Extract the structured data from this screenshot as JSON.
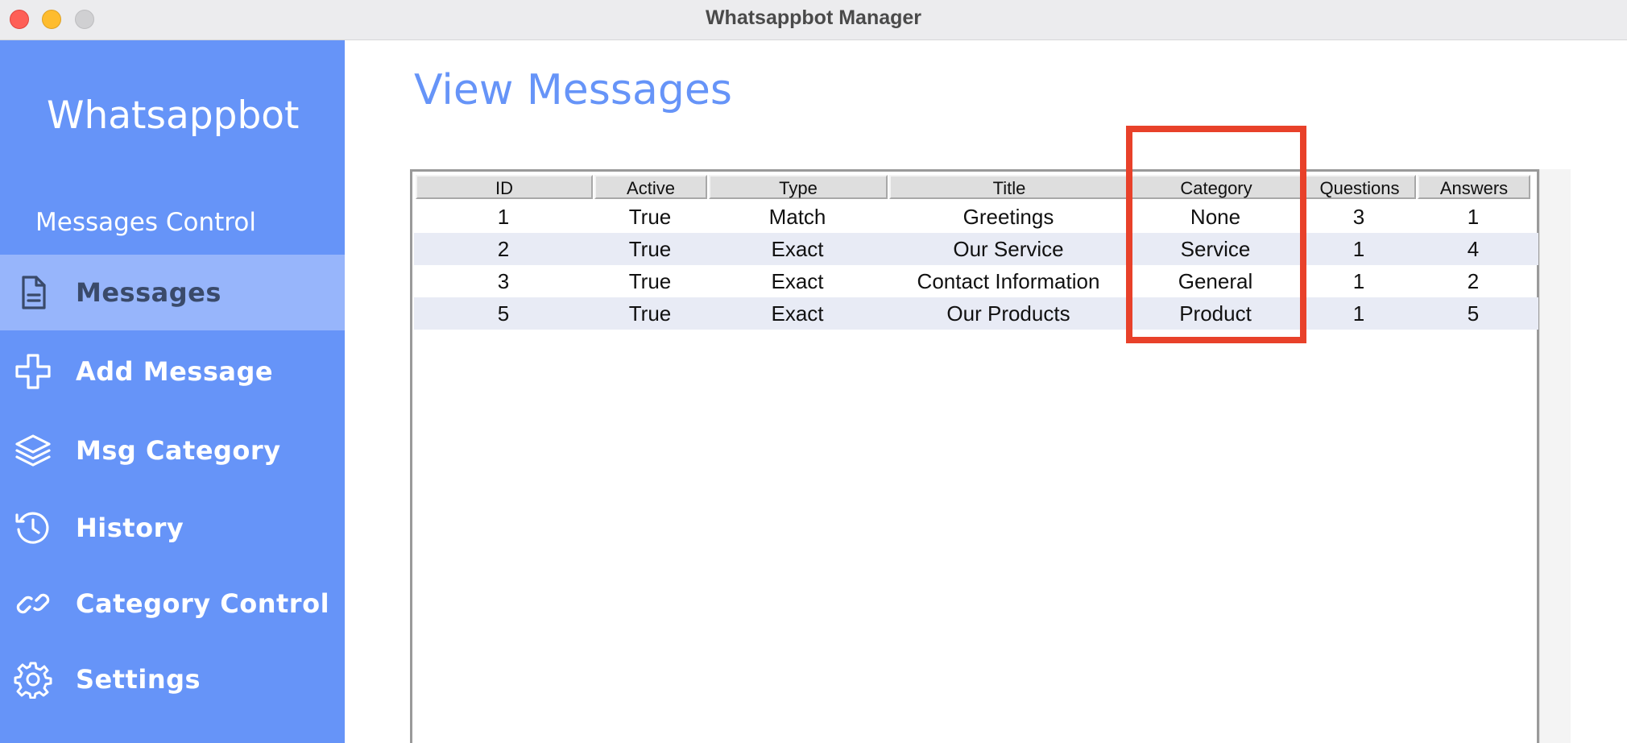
{
  "window": {
    "title": "Whatsappbot Manager"
  },
  "sidebar": {
    "brand": "Whatsappbot",
    "section_title": "Messages Control",
    "items": [
      {
        "label": "Messages",
        "icon": "document-icon",
        "active": true
      },
      {
        "label": "Add Message",
        "icon": "plus-icon",
        "active": false
      },
      {
        "label": "Msg Category",
        "icon": "layers-icon",
        "active": false
      },
      {
        "label": "History",
        "icon": "history-icon",
        "active": false
      },
      {
        "label": "Category Control",
        "icon": "link-icon",
        "active": false
      },
      {
        "label": "Settings",
        "icon": "gear-icon",
        "active": false
      }
    ]
  },
  "main": {
    "title": "View Messages",
    "table": {
      "columns": [
        "ID",
        "Active",
        "Type",
        "Title",
        "Category",
        "Questions",
        "Answers"
      ],
      "rows": [
        [
          "1",
          "True",
          "Match",
          "Greetings",
          "None",
          "3",
          "1"
        ],
        [
          "2",
          "True",
          "Exact",
          "Our Service",
          "Service",
          "1",
          "4"
        ],
        [
          "3",
          "True",
          "Exact",
          "Contact Information",
          "General",
          "1",
          "2"
        ],
        [
          "5",
          "True",
          "Exact",
          "Our Products",
          "Product",
          "1",
          "5"
        ]
      ]
    },
    "highlight": {
      "column": "Category",
      "color": "#e8412a"
    }
  },
  "colors": {
    "sidebar": "#6694f8",
    "sidebar_active": "#97b5fb",
    "accent": "#6694f8",
    "row_alt": "#e8ebf5"
  }
}
